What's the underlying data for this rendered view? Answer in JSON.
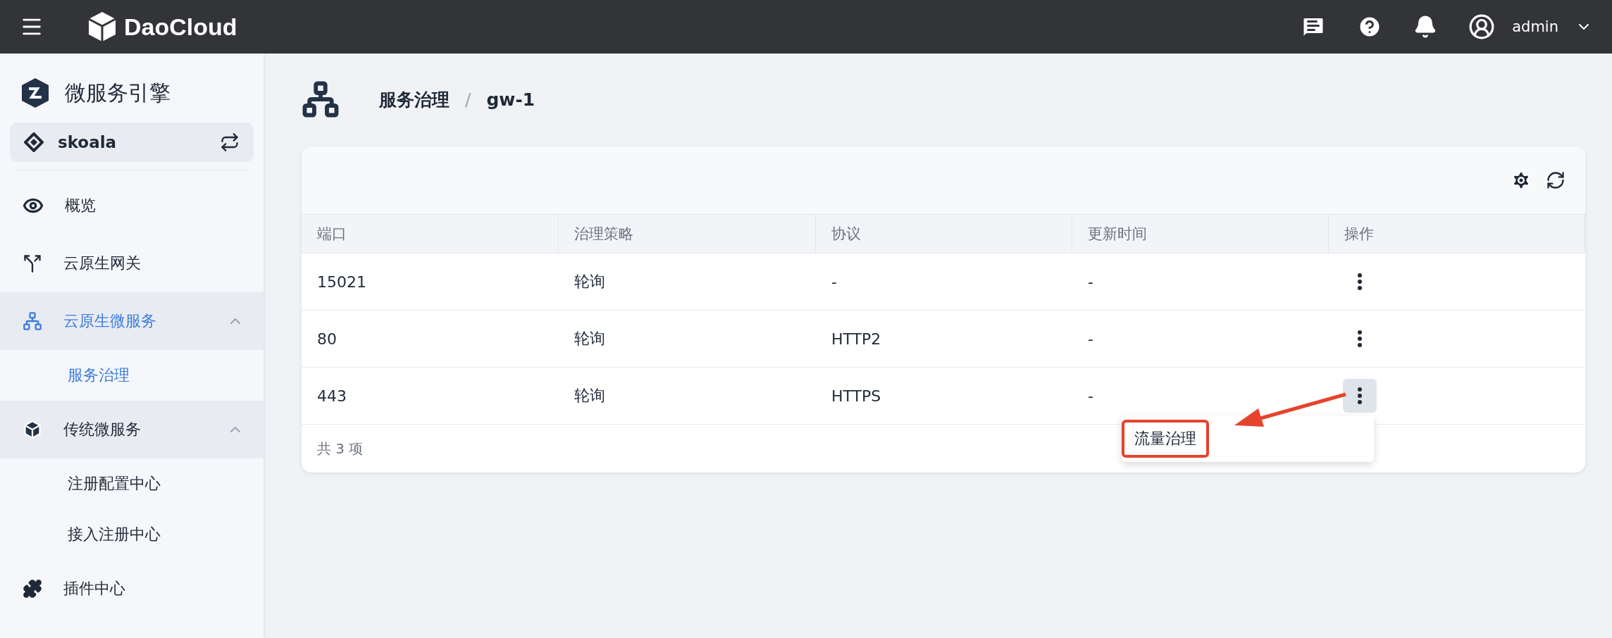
{
  "topbar": {
    "brand": "DaoCloud",
    "user": "admin"
  },
  "sidebar": {
    "title": "微服务引擎",
    "workspace": "skoala",
    "items": [
      {
        "kind": "item",
        "label": "概览",
        "selected": false
      },
      {
        "kind": "item",
        "label": "云原生网关",
        "selected": false
      },
      {
        "kind": "group",
        "label": "云原生微服务",
        "selected": true,
        "expanded": true,
        "children": [
          {
            "label": "服务治理",
            "selected": true
          }
        ]
      },
      {
        "kind": "group",
        "label": "传统微服务",
        "selected": false,
        "expanded": true,
        "children": [
          {
            "label": "注册配置中心",
            "selected": false
          },
          {
            "label": "接入注册中心",
            "selected": false
          }
        ]
      },
      {
        "kind": "item",
        "label": "插件中心",
        "selected": false
      }
    ]
  },
  "breadcrumb": {
    "items": [
      "服务治理",
      "gw-1"
    ],
    "separator": "/"
  },
  "table": {
    "columns": [
      "端口",
      "治理策略",
      "协议",
      "更新时间",
      "操作"
    ],
    "rows": [
      {
        "port": "15021",
        "policy": "轮询",
        "protocol": "-",
        "updated": "-",
        "menu_open": false
      },
      {
        "port": "80",
        "policy": "轮询",
        "protocol": "HTTP2",
        "updated": "-",
        "menu_open": false
      },
      {
        "port": "443",
        "policy": "轮询",
        "protocol": "HTTPS",
        "updated": "-",
        "menu_open": true
      }
    ],
    "footer": "共 3 项"
  },
  "menu": {
    "items": [
      {
        "label": "流量治理",
        "highlighted": true
      }
    ]
  }
}
